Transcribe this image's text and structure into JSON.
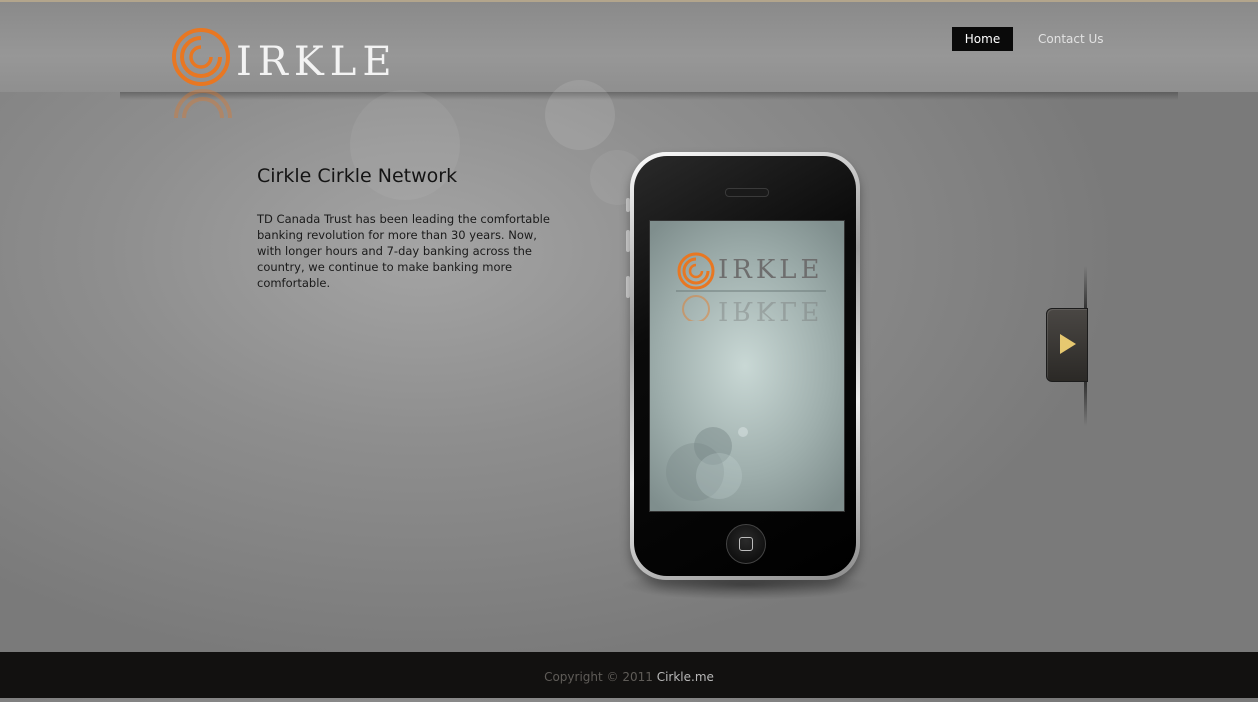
{
  "brand": {
    "logo_text": "IRKLE",
    "logo_alt": "Cirkle",
    "accent_color": "#e87722"
  },
  "nav": {
    "items": [
      {
        "label": "Home",
        "active": true
      },
      {
        "label": "Contact Us",
        "active": false
      }
    ]
  },
  "main": {
    "headline": "Cirkle Cirkle Network",
    "body": "TD Canada Trust has been leading the comfortable banking revolution for more than 30 years. Now, with longer hours and 7-day banking across the country, we continue to make banking more comfortable."
  },
  "device": {
    "screen_logo_text": "IRKLE"
  },
  "slider": {
    "next_icon": "play-triangle-icon",
    "icon_color": "#e6c870"
  },
  "footer": {
    "copyright": "Copyright © 2011 ",
    "site": "Cirkle.me"
  }
}
